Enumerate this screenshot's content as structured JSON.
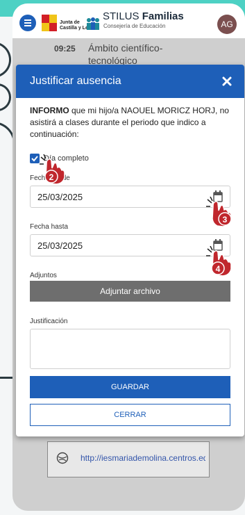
{
  "header": {
    "org_line1": "Junta de",
    "org_line2": "Castilla y León",
    "app_name": "STILUS",
    "app_name_bold": "Familias",
    "app_subtitle": "Consejería de Educación",
    "avatar_initials": "AG"
  },
  "background": {
    "time": "09:25",
    "subject_line1": "Ámbito científico-",
    "subject_line2": "tecnológico",
    "link_text": "http://iesmariademolina.centros.educa"
  },
  "modal": {
    "title": "Justificar ausencia",
    "intro_bold": "INFORMO",
    "intro_text": " que mi hijo/a NAOUEL MORICZ HORJ, no asistirá a clases durante el periodo que indico a continuación:",
    "checkbox_label": "Día completo",
    "date_from_label": "Fecha desde",
    "date_from_value": "25/03/2025",
    "date_to_label": "Fecha hasta",
    "date_to_value": "25/03/2025",
    "attachments_label": "Adjuntos",
    "attach_button": "Adjuntar archivo",
    "justification_label": "Justificación",
    "save_button": "GUARDAR",
    "close_button": "CERRAR"
  },
  "step_markers": [
    "2",
    "3",
    "4"
  ],
  "colors": {
    "primary": "#1e5fb8",
    "attach_button": "#6e6e6e",
    "top_band": "#4dd1c4",
    "marker": "#c0272d"
  }
}
